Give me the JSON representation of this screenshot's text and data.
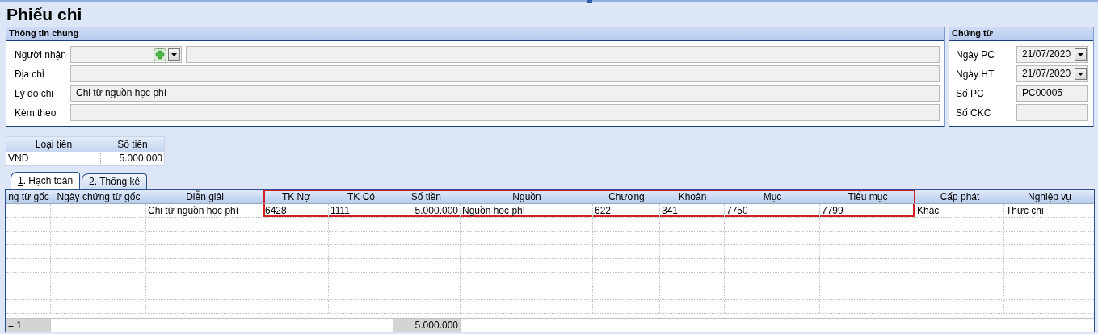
{
  "title": "Phiếu chi",
  "general": {
    "heading": "Thông tin chung",
    "fields": [
      {
        "label": "Người nhận",
        "kind": "combo"
      },
      {
        "label": "Địa chỉ",
        "kind": "text"
      },
      {
        "label": "Lý do chi",
        "kind": "text",
        "value": "Chi từ nguồn học phí"
      },
      {
        "label": "Kèm theo",
        "kind": "text"
      }
    ]
  },
  "voucher": {
    "heading": "Chứng từ",
    "fields": [
      {
        "label": "Ngày PC",
        "kind": "date",
        "value": "21/07/2020"
      },
      {
        "label": "Ngày HT",
        "kind": "date",
        "value": "21/07/2020"
      },
      {
        "label": "Số PC",
        "kind": "text",
        "value": "PC00005"
      },
      {
        "label": "Số CKC",
        "kind": "text"
      }
    ]
  },
  "currency": {
    "columns": [
      "Loại tiền",
      "Số tiền"
    ],
    "rows": [
      [
        "VND",
        "5.000.000"
      ]
    ]
  },
  "tabs": [
    {
      "key": "1",
      "label": ". Hạch toán",
      "selected": true
    },
    {
      "key": "2",
      "label": ". Thống kê",
      "selected": false
    }
  ],
  "grid": {
    "columns": [
      {
        "label": "ng từ gốc",
        "kind": "text",
        "highlighted": false
      },
      {
        "label": "Ngày chứng từ gốc",
        "kind": "text",
        "highlighted": false
      },
      {
        "label": "Diễn giải",
        "kind": "text",
        "highlighted": false
      },
      {
        "label": "TK Nợ",
        "kind": "text",
        "highlighted": true
      },
      {
        "label": "TK Có",
        "kind": "text",
        "highlighted": true
      },
      {
        "label": "Số tiền",
        "kind": "amount",
        "highlighted": true
      },
      {
        "label": "Nguồn",
        "kind": "text",
        "highlighted": true
      },
      {
        "label": "Chương",
        "kind": "text",
        "highlighted": true
      },
      {
        "label": "Khoản",
        "kind": "text",
        "highlighted": true
      },
      {
        "label": "Mục",
        "kind": "text",
        "highlighted": true
      },
      {
        "label": "Tiểu mục",
        "kind": "text",
        "highlighted": true
      },
      {
        "label": "Cấp phát",
        "kind": "text",
        "highlighted": false
      },
      {
        "label": "Nghiệp vụ",
        "kind": "text",
        "highlighted": false
      }
    ],
    "rows": [
      [
        null,
        null,
        "Chi từ nguồn học phí",
        "6428",
        "1111",
        "5.000.000",
        "Nguồn học phí",
        "622",
        "341",
        "7750",
        "7799",
        "Khác",
        "Thực chi"
      ]
    ],
    "footer": {
      "count": "= 1",
      "total": "5.000.000"
    }
  }
}
